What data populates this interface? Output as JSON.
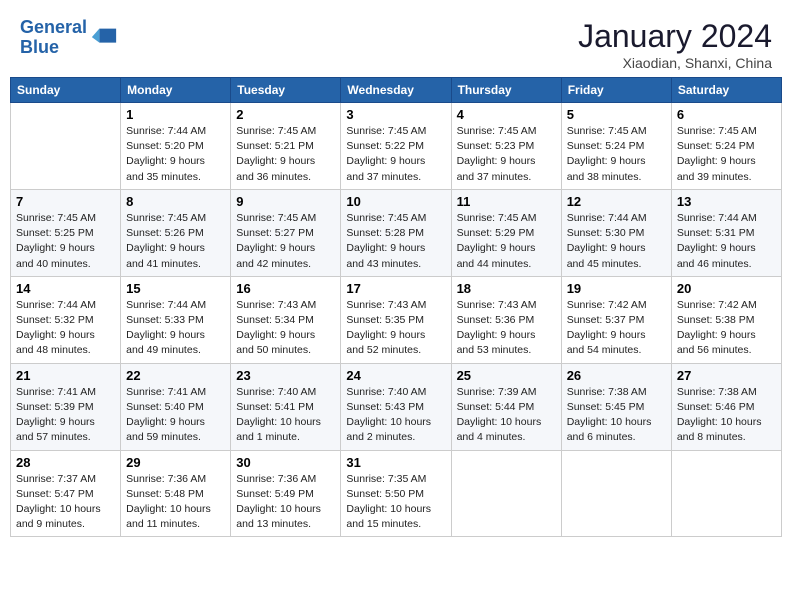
{
  "header": {
    "logo_line1": "General",
    "logo_line2": "Blue",
    "month_year": "January 2024",
    "location": "Xiaodian, Shanxi, China"
  },
  "weekdays": [
    "Sunday",
    "Monday",
    "Tuesday",
    "Wednesday",
    "Thursday",
    "Friday",
    "Saturday"
  ],
  "weeks": [
    [
      {
        "day": "",
        "info": ""
      },
      {
        "day": "1",
        "info": "Sunrise: 7:44 AM\nSunset: 5:20 PM\nDaylight: 9 hours\nand 35 minutes."
      },
      {
        "day": "2",
        "info": "Sunrise: 7:45 AM\nSunset: 5:21 PM\nDaylight: 9 hours\nand 36 minutes."
      },
      {
        "day": "3",
        "info": "Sunrise: 7:45 AM\nSunset: 5:22 PM\nDaylight: 9 hours\nand 37 minutes."
      },
      {
        "day": "4",
        "info": "Sunrise: 7:45 AM\nSunset: 5:23 PM\nDaylight: 9 hours\nand 37 minutes."
      },
      {
        "day": "5",
        "info": "Sunrise: 7:45 AM\nSunset: 5:24 PM\nDaylight: 9 hours\nand 38 minutes."
      },
      {
        "day": "6",
        "info": "Sunrise: 7:45 AM\nSunset: 5:24 PM\nDaylight: 9 hours\nand 39 minutes."
      }
    ],
    [
      {
        "day": "7",
        "info": "Sunrise: 7:45 AM\nSunset: 5:25 PM\nDaylight: 9 hours\nand 40 minutes."
      },
      {
        "day": "8",
        "info": "Sunrise: 7:45 AM\nSunset: 5:26 PM\nDaylight: 9 hours\nand 41 minutes."
      },
      {
        "day": "9",
        "info": "Sunrise: 7:45 AM\nSunset: 5:27 PM\nDaylight: 9 hours\nand 42 minutes."
      },
      {
        "day": "10",
        "info": "Sunrise: 7:45 AM\nSunset: 5:28 PM\nDaylight: 9 hours\nand 43 minutes."
      },
      {
        "day": "11",
        "info": "Sunrise: 7:45 AM\nSunset: 5:29 PM\nDaylight: 9 hours\nand 44 minutes."
      },
      {
        "day": "12",
        "info": "Sunrise: 7:44 AM\nSunset: 5:30 PM\nDaylight: 9 hours\nand 45 minutes."
      },
      {
        "day": "13",
        "info": "Sunrise: 7:44 AM\nSunset: 5:31 PM\nDaylight: 9 hours\nand 46 minutes."
      }
    ],
    [
      {
        "day": "14",
        "info": "Sunrise: 7:44 AM\nSunset: 5:32 PM\nDaylight: 9 hours\nand 48 minutes."
      },
      {
        "day": "15",
        "info": "Sunrise: 7:44 AM\nSunset: 5:33 PM\nDaylight: 9 hours\nand 49 minutes."
      },
      {
        "day": "16",
        "info": "Sunrise: 7:43 AM\nSunset: 5:34 PM\nDaylight: 9 hours\nand 50 minutes."
      },
      {
        "day": "17",
        "info": "Sunrise: 7:43 AM\nSunset: 5:35 PM\nDaylight: 9 hours\nand 52 minutes."
      },
      {
        "day": "18",
        "info": "Sunrise: 7:43 AM\nSunset: 5:36 PM\nDaylight: 9 hours\nand 53 minutes."
      },
      {
        "day": "19",
        "info": "Sunrise: 7:42 AM\nSunset: 5:37 PM\nDaylight: 9 hours\nand 54 minutes."
      },
      {
        "day": "20",
        "info": "Sunrise: 7:42 AM\nSunset: 5:38 PM\nDaylight: 9 hours\nand 56 minutes."
      }
    ],
    [
      {
        "day": "21",
        "info": "Sunrise: 7:41 AM\nSunset: 5:39 PM\nDaylight: 9 hours\nand 57 minutes."
      },
      {
        "day": "22",
        "info": "Sunrise: 7:41 AM\nSunset: 5:40 PM\nDaylight: 9 hours\nand 59 minutes."
      },
      {
        "day": "23",
        "info": "Sunrise: 7:40 AM\nSunset: 5:41 PM\nDaylight: 10 hours\nand 1 minute."
      },
      {
        "day": "24",
        "info": "Sunrise: 7:40 AM\nSunset: 5:43 PM\nDaylight: 10 hours\nand 2 minutes."
      },
      {
        "day": "25",
        "info": "Sunrise: 7:39 AM\nSunset: 5:44 PM\nDaylight: 10 hours\nand 4 minutes."
      },
      {
        "day": "26",
        "info": "Sunrise: 7:38 AM\nSunset: 5:45 PM\nDaylight: 10 hours\nand 6 minutes."
      },
      {
        "day": "27",
        "info": "Sunrise: 7:38 AM\nSunset: 5:46 PM\nDaylight: 10 hours\nand 8 minutes."
      }
    ],
    [
      {
        "day": "28",
        "info": "Sunrise: 7:37 AM\nSunset: 5:47 PM\nDaylight: 10 hours\nand 9 minutes."
      },
      {
        "day": "29",
        "info": "Sunrise: 7:36 AM\nSunset: 5:48 PM\nDaylight: 10 hours\nand 11 minutes."
      },
      {
        "day": "30",
        "info": "Sunrise: 7:36 AM\nSunset: 5:49 PM\nDaylight: 10 hours\nand 13 minutes."
      },
      {
        "day": "31",
        "info": "Sunrise: 7:35 AM\nSunset: 5:50 PM\nDaylight: 10 hours\nand 15 minutes."
      },
      {
        "day": "",
        "info": ""
      },
      {
        "day": "",
        "info": ""
      },
      {
        "day": "",
        "info": ""
      }
    ]
  ]
}
